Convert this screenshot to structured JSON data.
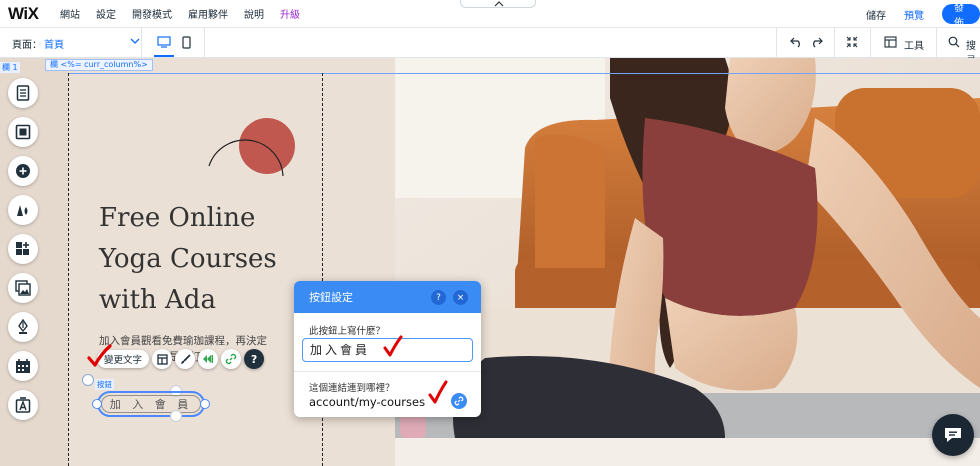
{
  "topbar": {
    "logo": "WiX",
    "menu": [
      "網站",
      "設定",
      "開發模式",
      "雇用夥伴",
      "說明",
      "升級"
    ],
    "save_label": "儲存",
    "preview_label": "預覽",
    "publish_label": "發佈"
  },
  "toolbar2": {
    "page_label": "頁面：",
    "page_value": "首頁",
    "tools_label": "工具",
    "search_label": "搜尋"
  },
  "canvas": {
    "column_label": "欄 1",
    "column_tag": "欄 <%= curr_column%>",
    "hero_title_lines": [
      "Free Online",
      "Yoga Courses",
      "with Ada"
    ],
    "hero_text_line1": "加入會員觀看免費瑜珈課程，再決定",
    "hero_text_line2": "是否訂閱",
    "button_text": "加 入 會 員",
    "button_tag": "按鈕",
    "change_text_label": "變更文字",
    "help_symbol": "?"
  },
  "dialog": {
    "title": "按鈕設定",
    "help_symbol": "?",
    "close_symbol": "×",
    "question_text": "此按鈕上寫什麼？",
    "button_text_value": "加入會員",
    "question_link": "這個連結連到哪裡？",
    "link_value": "account/my-courses"
  },
  "rail": {
    "icons": [
      "pages-icon",
      "section-icon",
      "add-icon",
      "theme-icon",
      "apps-icon",
      "media-icon",
      "blog-icon",
      "bookings-icon",
      "cms-icon"
    ]
  },
  "colors": {
    "accent": "#116dff",
    "dialog_header": "#3b8bf4",
    "beige": "#ebe0d6",
    "circle": "#c0584f",
    "check": "#e00000",
    "upgrade": "#9a27d5"
  }
}
